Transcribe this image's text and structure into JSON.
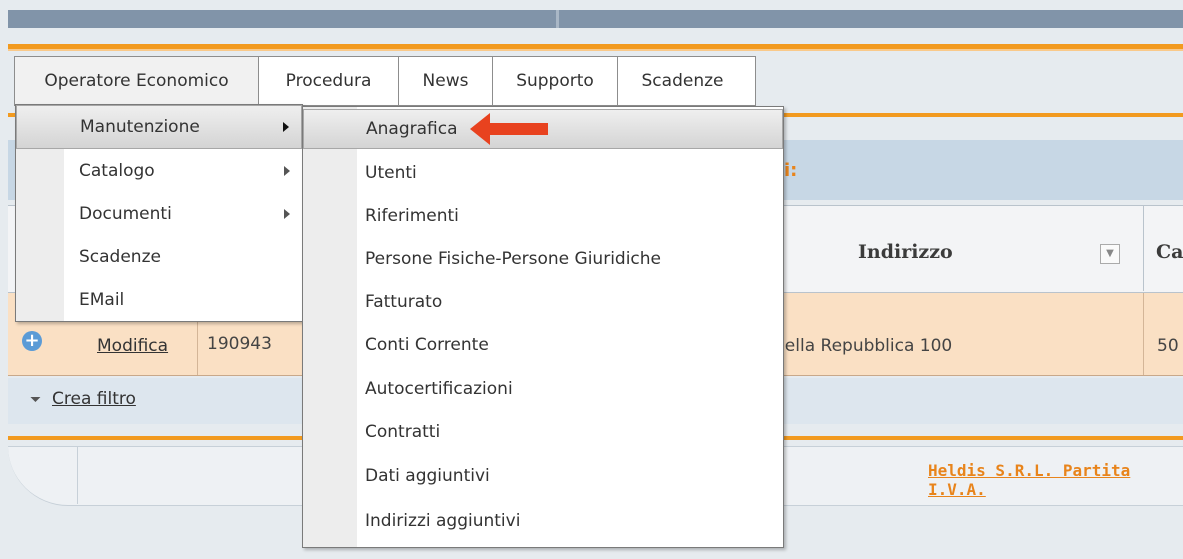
{
  "menubar": {
    "tabs": [
      {
        "label": "Operatore Economico"
      },
      {
        "label": "Procedura"
      },
      {
        "label": "News"
      },
      {
        "label": "Supporto"
      },
      {
        "label": "Scadenze"
      }
    ]
  },
  "dropdown_l1": {
    "items": [
      {
        "label": "Manutenzione",
        "has_submenu": true,
        "highlighted": true
      },
      {
        "label": "Catalogo",
        "has_submenu": true
      },
      {
        "label": "Documenti",
        "has_submenu": true
      },
      {
        "label": "Scadenze",
        "has_submenu": false
      },
      {
        "label": "EMail",
        "has_submenu": false
      }
    ]
  },
  "dropdown_l2": {
    "items": [
      {
        "label": "Anagrafica",
        "highlighted": true
      },
      {
        "label": "Utenti"
      },
      {
        "label": "Riferimenti"
      },
      {
        "label": "Persone Fisiche-Persone Giuridiche"
      },
      {
        "label": "Fatturato"
      },
      {
        "label": "Conti Corrente"
      },
      {
        "label": "Autocertificazioni"
      },
      {
        "label": "Contratti"
      },
      {
        "label": "Dati aggiuntivi"
      },
      {
        "label": "Indirizzi aggiuntivi"
      }
    ]
  },
  "background": {
    "section_title_partial": "i:",
    "table": {
      "header_indirizzo": "Indirizzo",
      "header_next_partial": "Ca",
      "row": {
        "action": "Modifica",
        "id": "190943",
        "address_partial": "della Repubblica 100",
        "next_partial": "50"
      }
    },
    "filter_link": "Crea filtro",
    "footer_partial": "Heldis S.R.L. Partita I.V.A."
  },
  "colors": {
    "accent_orange": "#f29a1f",
    "banner": "#8194a9",
    "row_highlight": "#fae0c4",
    "annotation_arrow": "#e8421f"
  },
  "icons": {
    "submenu": "triangle-right-icon",
    "add": "plus-circle-icon",
    "filter": "funnel-icon",
    "sort": "sort-dropdown-icon",
    "annotation": "red-arrow-left-icon"
  }
}
